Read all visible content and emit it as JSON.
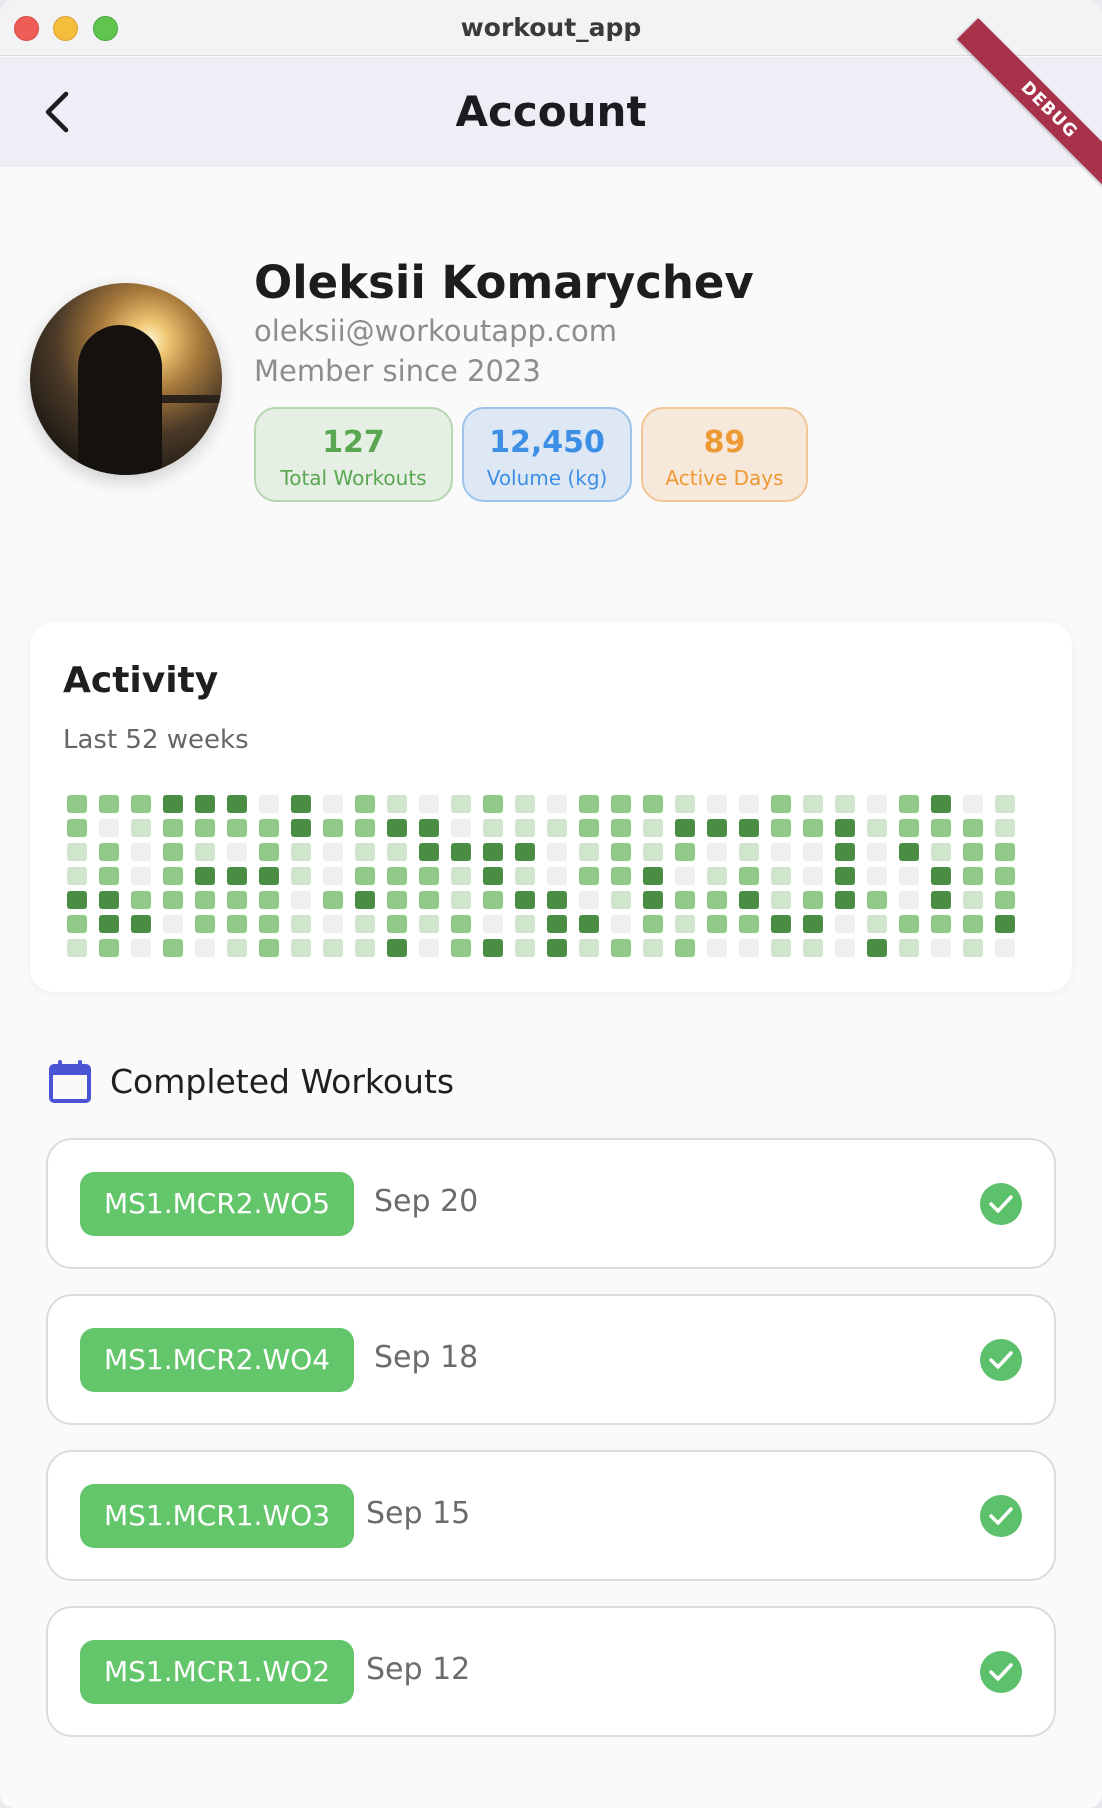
{
  "window": {
    "title": "workout_app"
  },
  "appbar": {
    "title": "Account",
    "debug_label": "DEBUG"
  },
  "profile": {
    "name": "Oleksii Komarychev",
    "email": "oleksii@workoutapp.com",
    "member_since": "Member since 2023"
  },
  "stats": [
    {
      "value": "127",
      "label": "Total Workouts",
      "color": "#5aa752"
    },
    {
      "value": "12,450",
      "label": "Volume (kg)",
      "color": "#3d8fe6"
    },
    {
      "value": "89",
      "label": "Active Days",
      "color": "#ee9a34"
    }
  ],
  "activity": {
    "title": "Activity",
    "subtitle": "Last 52 weeks",
    "level_colors": [
      "#eeeff1",
      "#cfe6cc",
      "#92c98a",
      "#4a8c44"
    ],
    "grid": [
      [
        2,
        2,
        2,
        3,
        3,
        3,
        0,
        3,
        0,
        2,
        1,
        0,
        1,
        2,
        1,
        0,
        2,
        2,
        2,
        1,
        0,
        0,
        2,
        1,
        1,
        0,
        2,
        3,
        0,
        1
      ],
      [
        2,
        0,
        1,
        2,
        2,
        2,
        2,
        3,
        2,
        2,
        3,
        3,
        0,
        1,
        1,
        1,
        2,
        2,
        1,
        3,
        3,
        3,
        2,
        2,
        3,
        1,
        2,
        2,
        2,
        1
      ],
      [
        1,
        2,
        0,
        2,
        1,
        0,
        2,
        1,
        0,
        1,
        1,
        3,
        3,
        3,
        3,
        0,
        1,
        2,
        1,
        2,
        0,
        1,
        0,
        0,
        3,
        0,
        3,
        1,
        2,
        2
      ],
      [
        1,
        2,
        0,
        2,
        3,
        3,
        3,
        1,
        0,
        2,
        2,
        2,
        1,
        3,
        1,
        0,
        2,
        2,
        3,
        0,
        1,
        2,
        1,
        0,
        3,
        0,
        0,
        3,
        2,
        2
      ],
      [
        3,
        3,
        2,
        2,
        2,
        2,
        2,
        0,
        2,
        3,
        2,
        2,
        1,
        2,
        3,
        3,
        0,
        1,
        3,
        2,
        2,
        3,
        1,
        2,
        3,
        2,
        0,
        3,
        1,
        2
      ],
      [
        2,
        3,
        3,
        0,
        2,
        2,
        2,
        1,
        0,
        1,
        2,
        1,
        2,
        0,
        1,
        3,
        3,
        0,
        2,
        1,
        2,
        2,
        3,
        3,
        0,
        1,
        2,
        2,
        2,
        3
      ],
      [
        1,
        2,
        0,
        2,
        0,
        1,
        2,
        1,
        1,
        1,
        3,
        0,
        2,
        3,
        1,
        3,
        1,
        2,
        1,
        2,
        0,
        0,
        1,
        1,
        0,
        3,
        1,
        0,
        1,
        0
      ]
    ]
  },
  "completed": {
    "title": "Completed Workouts",
    "items": [
      {
        "code": "MS1.MCR2.WO5",
        "date": "Sep 20",
        "done": true
      },
      {
        "code": "MS1.MCR2.WO4",
        "date": "Sep 18",
        "done": true
      },
      {
        "code": "MS1.MCR1.WO3",
        "date": "Sep 15",
        "done": true
      },
      {
        "code": "MS1.MCR1.WO2",
        "date": "Sep 12",
        "done": true
      }
    ]
  },
  "icons": {
    "back": "arrow-back-icon",
    "calendar": "calendar-icon",
    "check": "check-circle-icon"
  }
}
